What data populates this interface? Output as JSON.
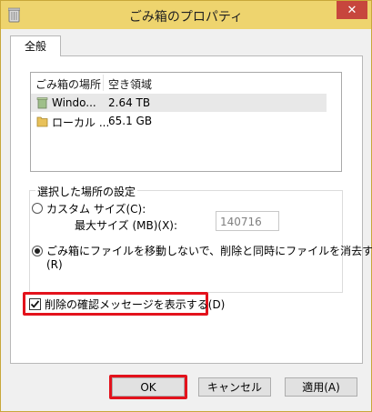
{
  "window": {
    "title": "ごみ箱のプロパティ",
    "close_glyph": "✕"
  },
  "tabs": [
    {
      "label": "全般"
    }
  ],
  "list": {
    "columns": [
      "ごみ箱の場所",
      "空き領域"
    ],
    "rows": [
      {
        "name": "Windo...",
        "free": "2.64 TB",
        "icon": "recycle-bin-icon"
      },
      {
        "name": "ローカル ...",
        "free": "65.1 GB",
        "icon": "folder-icon"
      }
    ]
  },
  "settings": {
    "group_label": "選択した場所の設定",
    "custom_size_label": "カスタム サイズ(C):",
    "max_size_label": "最大サイズ (MB)(X):",
    "max_size_value": "140716",
    "no_recycle_label_line1": "ごみ箱にファイルを移動しないで、削除と同時にファイルを消去する",
    "no_recycle_label_line2": "(R)",
    "confirm_delete_label": "削除の確認メッセージを表示する(D)"
  },
  "buttons": {
    "ok": "OK",
    "cancel": "キャンセル",
    "apply": "適用(A)"
  },
  "colors": {
    "titlebar": "#eed46e",
    "close": "#c7463d",
    "highlight": "#e3121c"
  }
}
